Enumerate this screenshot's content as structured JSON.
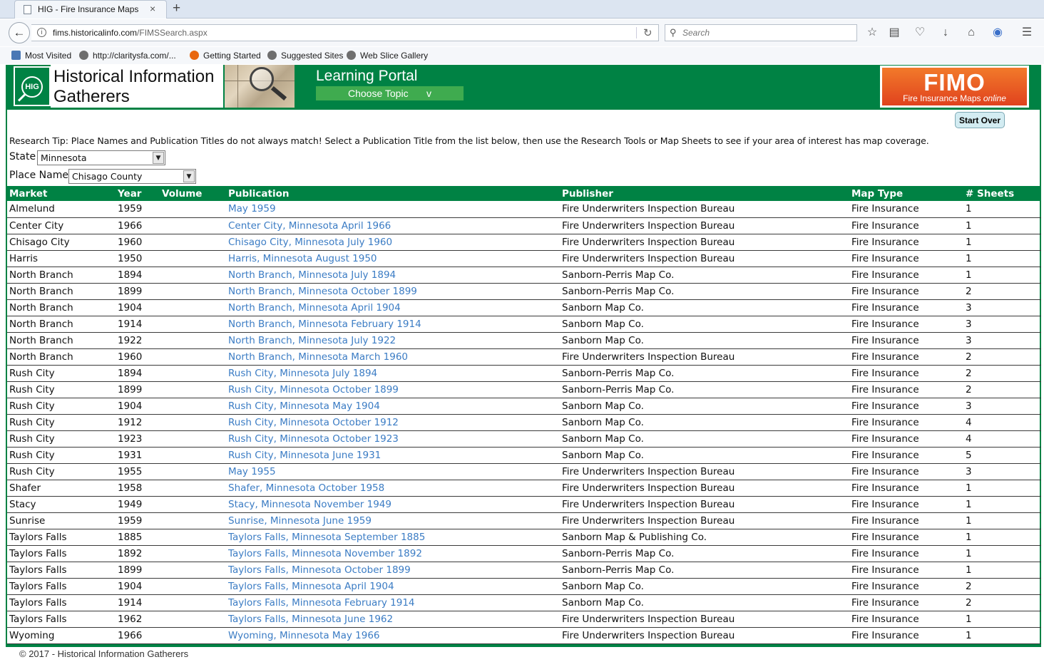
{
  "browser": {
    "tab_title": "HIG - Fire Insurance Maps",
    "tab_close": "×",
    "new_tab": "+",
    "url_host": "fims.historicalinfo.com",
    "url_path": "/FIMSSearch.aspx",
    "search_placeholder": "Search",
    "bookmarks": [
      "Most Visited",
      "http://claritysfa.com/...",
      "Getting Started",
      "Suggested Sites",
      "Web Slice Gallery"
    ]
  },
  "header": {
    "logo_text": "HIG",
    "org_name_line1": "Historical Information",
    "org_name_line2": "Gatherers",
    "portal_title": "Learning Portal",
    "topic_button": "Choose Topic",
    "topic_caret": "v",
    "fimo_logo": "FIMO",
    "fimo_tagline": "Fire Insurance Maps",
    "fimo_tagline_italic": "online"
  },
  "controls": {
    "start_over": "Start Over",
    "research_tip": "Research Tip: Place Names and Publication Titles do not always match! Select a Publication Title from the list below, then use the Research Tools or Map Sheets to see if your area of interest has map coverage.",
    "state_label": "State",
    "state_value": "Minnesota",
    "place_label": "Place Name",
    "place_value": "Chisago County"
  },
  "table": {
    "columns": [
      "Market",
      "Year",
      "Volume",
      "Publication",
      "Publisher",
      "Map Type",
      "# Sheets"
    ],
    "rows": [
      [
        "Almelund",
        "1959",
        "",
        "May 1959",
        "Fire Underwriters Inspection Bureau",
        "Fire Insurance",
        "1"
      ],
      [
        "Center City",
        "1966",
        "",
        "Center City, Minnesota April 1966",
        "Fire Underwriters Inspection Bureau",
        "Fire Insurance",
        "1"
      ],
      [
        "Chisago City",
        "1960",
        "",
        "Chisago City, Minnesota July 1960",
        "Fire Underwriters Inspection Bureau",
        "Fire Insurance",
        "1"
      ],
      [
        "Harris",
        "1950",
        "",
        "Harris, Minnesota August 1950",
        "Fire Underwriters Inspection Bureau",
        "Fire Insurance",
        "1"
      ],
      [
        "North Branch",
        "1894",
        "",
        "North Branch, Minnesota July 1894",
        "Sanborn-Perris Map Co.",
        "Fire Insurance",
        "1"
      ],
      [
        "North Branch",
        "1899",
        "",
        "North Branch, Minnesota October 1899",
        "Sanborn-Perris Map Co.",
        "Fire Insurance",
        "2"
      ],
      [
        "North Branch",
        "1904",
        "",
        "North Branch, Minnesota April 1904",
        "Sanborn Map Co.",
        "Fire Insurance",
        "3"
      ],
      [
        "North Branch",
        "1914",
        "",
        "North Branch, Minnesota February 1914",
        "Sanborn Map Co.",
        "Fire Insurance",
        "3"
      ],
      [
        "North Branch",
        "1922",
        "",
        "North Branch, Minnesota July 1922",
        "Sanborn Map Co.",
        "Fire Insurance",
        "3"
      ],
      [
        "North Branch",
        "1960",
        "",
        "North Branch, Minnesota March 1960",
        "Fire Underwriters Inspection Bureau",
        "Fire Insurance",
        "2"
      ],
      [
        "Rush City",
        "1894",
        "",
        "Rush City, Minnesota July 1894",
        "Sanborn-Perris Map Co.",
        "Fire Insurance",
        "2"
      ],
      [
        "Rush City",
        "1899",
        "",
        "Rush City, Minnesota October 1899",
        "Sanborn-Perris Map Co.",
        "Fire Insurance",
        "2"
      ],
      [
        "Rush City",
        "1904",
        "",
        "Rush City, Minnesota May 1904",
        "Sanborn Map Co.",
        "Fire Insurance",
        "3"
      ],
      [
        "Rush City",
        "1912",
        "",
        "Rush City, Minnesota October 1912",
        "Sanborn Map Co.",
        "Fire Insurance",
        "4"
      ],
      [
        "Rush City",
        "1923",
        "",
        "Rush City, Minnesota October 1923",
        "Sanborn Map Co.",
        "Fire Insurance",
        "4"
      ],
      [
        "Rush City",
        "1931",
        "",
        "Rush City, Minnesota June 1931",
        "Sanborn Map Co.",
        "Fire Insurance",
        "5"
      ],
      [
        "Rush City",
        "1955",
        "",
        "May 1955",
        "Fire Underwriters Inspection Bureau",
        "Fire Insurance",
        "3"
      ],
      [
        "Shafer",
        "1958",
        "",
        "Shafer, Minnesota October 1958",
        "Fire Underwriters Inspection Bureau",
        "Fire Insurance",
        "1"
      ],
      [
        "Stacy",
        "1949",
        "",
        "Stacy, Minnesota November 1949",
        "Fire Underwriters Inspection Bureau",
        "Fire Insurance",
        "1"
      ],
      [
        "Sunrise",
        "1959",
        "",
        "Sunrise, Minnesota June 1959",
        "Fire Underwriters Inspection Bureau",
        "Fire Insurance",
        "1"
      ],
      [
        "Taylors Falls",
        "1885",
        "",
        "Taylors Falls, Minnesota September 1885",
        "Sanborn Map & Publishing Co.",
        "Fire Insurance",
        "1"
      ],
      [
        "Taylors Falls",
        "1892",
        "",
        "Taylors Falls, Minnesota November 1892",
        "Sanborn-Perris Map Co.",
        "Fire Insurance",
        "1"
      ],
      [
        "Taylors Falls",
        "1899",
        "",
        "Taylors Falls, Minnesota October 1899",
        "Sanborn-Perris Map Co.",
        "Fire Insurance",
        "1"
      ],
      [
        "Taylors Falls",
        "1904",
        "",
        "Taylors Falls, Minnesota April 1904",
        "Sanborn Map Co.",
        "Fire Insurance",
        "2"
      ],
      [
        "Taylors Falls",
        "1914",
        "",
        "Taylors Falls, Minnesota February 1914",
        "Sanborn Map Co.",
        "Fire Insurance",
        "2"
      ],
      [
        "Taylors Falls",
        "1962",
        "",
        "Taylors Falls, Minnesota June 1962",
        "Fire Underwriters Inspection Bureau",
        "Fire Insurance",
        "1"
      ],
      [
        "Wyoming",
        "1966",
        "",
        "Wyoming, Minnesota May 1966",
        "Fire Underwriters Inspection Bureau",
        "Fire Insurance",
        "1"
      ]
    ]
  },
  "footer": {
    "copyright": "© 2017 - Historical Information Gatherers"
  },
  "colors": {
    "brand_green": "#008244",
    "link_blue": "#3b7cc4",
    "fimo_orange": "#e0421e"
  },
  "icons": {
    "back": "back-arrow-icon",
    "reload": "reload-icon",
    "search": "search-icon",
    "bookmark": "star-icon",
    "reading_list": "reading-list-icon",
    "pocket": "pocket-icon",
    "download": "download-icon",
    "home": "home-icon",
    "menu": "hamburger-menu-icon"
  }
}
